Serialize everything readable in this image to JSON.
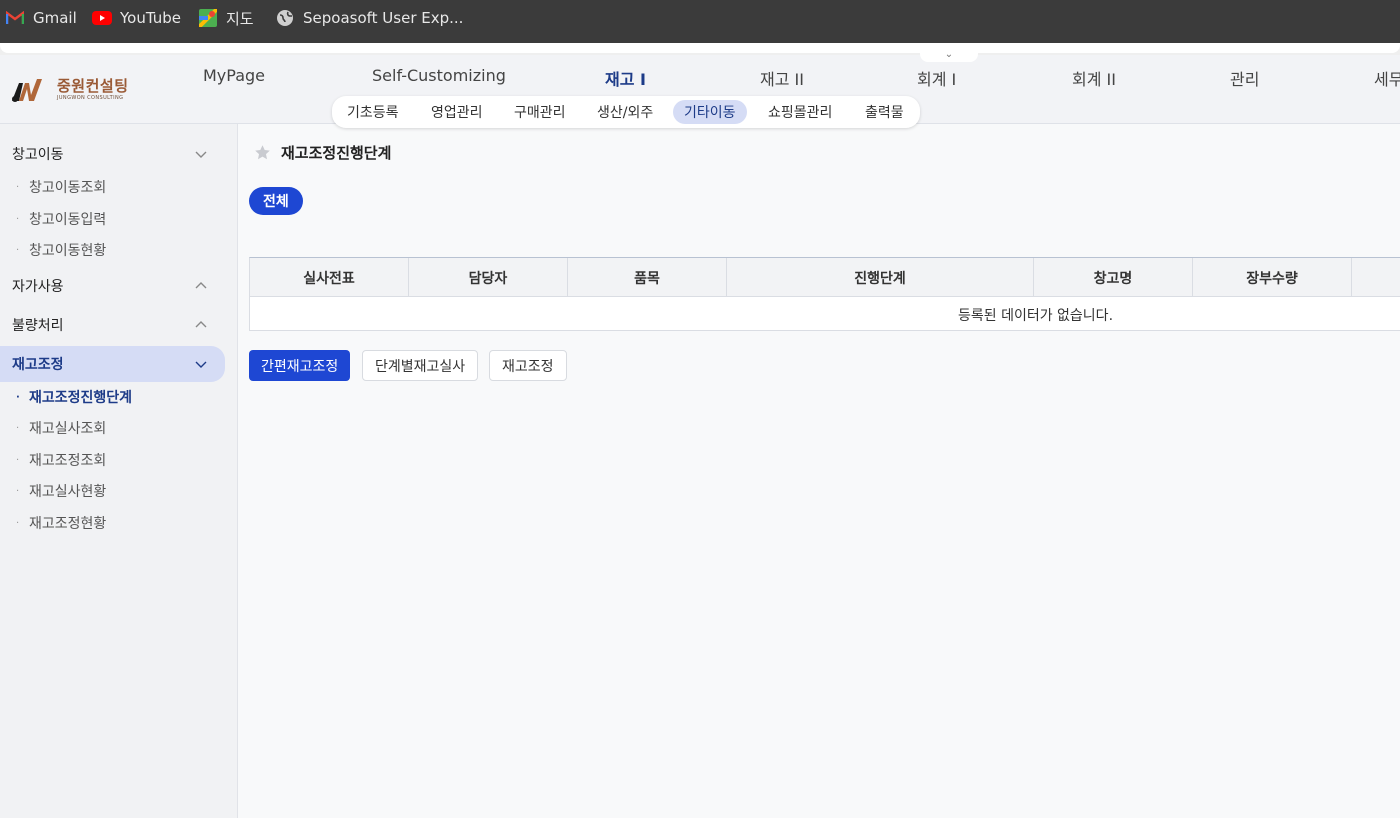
{
  "bookmarks": [
    {
      "label": "Gmail",
      "icon": "gmail-icon"
    },
    {
      "label": "YouTube",
      "icon": "youtube-icon"
    },
    {
      "label": "지도",
      "icon": "maps-icon"
    },
    {
      "label": "Sepoasoft User Exp...",
      "icon": "globe-icon"
    }
  ],
  "header": {
    "logo": {
      "text": "중원컨설팅",
      "subtext": "JUNGWON CONSULTING"
    },
    "menus": [
      "MyPage",
      "Self-Customizing",
      "재고 I",
      "재고 II",
      "회계 I",
      "회계 II",
      "관리",
      "세무"
    ],
    "active_menu": "재고 I",
    "submenus": [
      "기초등록",
      "영업관리",
      "구매관리",
      "생산/외주",
      "기타이동",
      "쇼핑몰관리",
      "출력물"
    ],
    "active_submenu": "기타이동"
  },
  "sidebar": {
    "groups": [
      {
        "label": "창고이동",
        "expanded": true,
        "items": [
          "창고이동조회",
          "창고이동입력",
          "창고이동현황"
        ]
      },
      {
        "label": "자가사용",
        "expanded": false,
        "items": []
      },
      {
        "label": "불량처리",
        "expanded": false,
        "items": []
      },
      {
        "label": "재고조정",
        "expanded": true,
        "active": true,
        "items": [
          "재고조정진행단계",
          "재고실사조회",
          "재고조정조회",
          "재고실사현황",
          "재고조정현황"
        ],
        "active_item": "재고조정진행단계"
      }
    ]
  },
  "main": {
    "title": "재고조정진행단계",
    "filter_button": "전체",
    "table": {
      "columns": [
        "실사전표",
        "담당자",
        "품목",
        "진행단계",
        "창고명",
        "장부수량"
      ],
      "empty_message": "등록된 데이터가 없습니다."
    },
    "actions": [
      {
        "label": "간편재고조정",
        "style": "primary"
      },
      {
        "label": "단계별재고실사",
        "style": "secondary"
      },
      {
        "label": "재고조정",
        "style": "secondary"
      }
    ]
  },
  "colors": {
    "accent": "#1e47d3",
    "active_bg": "#d5dcf5",
    "active_text": "#1d3b88",
    "bookmarks_bg": "#3b3b3b"
  }
}
